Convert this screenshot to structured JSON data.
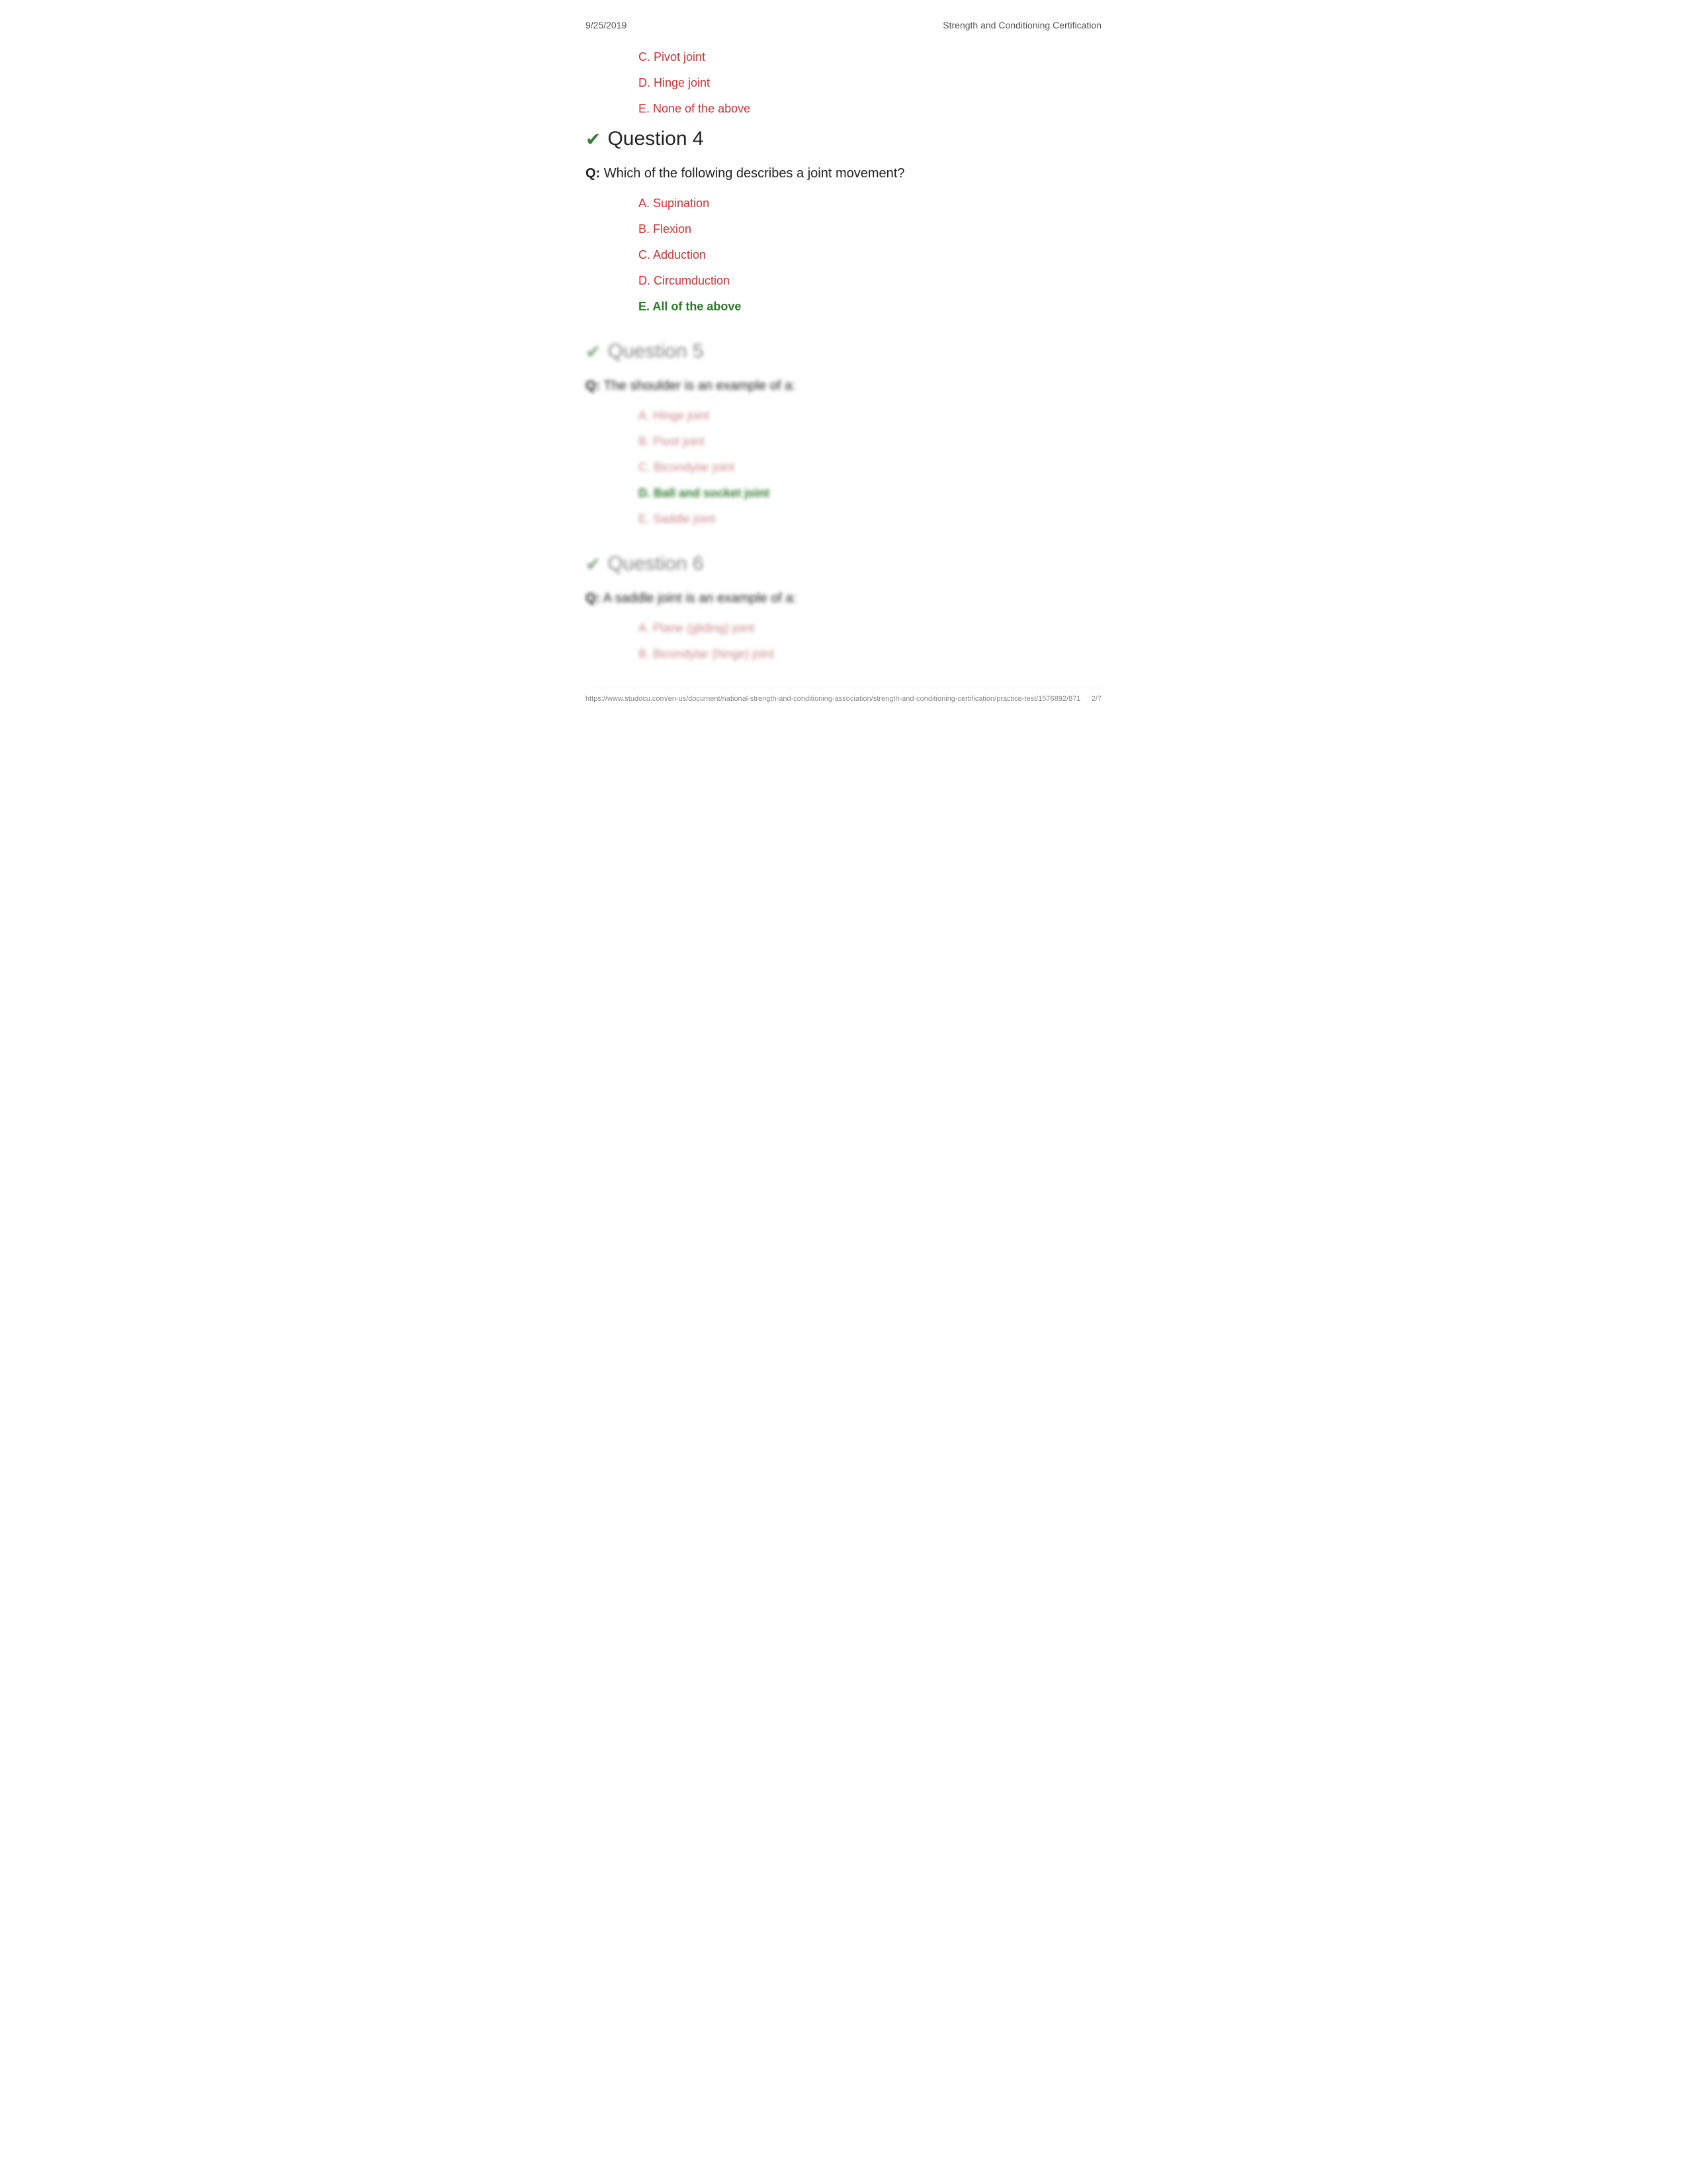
{
  "header": {
    "date": "9/25/2019",
    "title": "Strength and Conditioning Certification"
  },
  "previous_options": [
    {
      "label": "C. Pivot joint",
      "correct": false
    },
    {
      "label": "D. Hinge joint",
      "correct": false
    },
    {
      "label": "E. None of the above",
      "correct": false
    }
  ],
  "question4": {
    "number": "Question 4",
    "question_prefix": "Q:",
    "question_text": "Which of the following describes a joint movement?",
    "options": [
      {
        "label": "A. Supination",
        "correct": false
      },
      {
        "label": "B. Flexion",
        "correct": false
      },
      {
        "label": "C. Adduction",
        "correct": false
      },
      {
        "label": "D. Circumduction",
        "correct": false
      },
      {
        "label": "E. All of the above",
        "correct": true
      }
    ]
  },
  "question5": {
    "number": "Question 5",
    "question_text": "The shoulder is an example of a:",
    "options": [
      {
        "label": "A. Hinge joint",
        "correct": false
      },
      {
        "label": "B. Pivot joint",
        "correct": false
      },
      {
        "label": "C. Bicondylar joint",
        "correct": false
      },
      {
        "label": "D. Ball and socket joint",
        "correct": true
      },
      {
        "label": "E. Saddle joint",
        "correct": false
      }
    ]
  },
  "question6": {
    "number": "Question 6",
    "question_text": "A saddle joint is an example of a:",
    "options": [
      {
        "label": "A. Plane (gliding) joint",
        "correct": false
      },
      {
        "label": "B. Bicondylar (hinge) joint",
        "correct": false
      }
    ]
  },
  "footer": {
    "url": "https://www.studocu.com/en-us/document/national-strength-and-conditioning-association/strength-and-conditioning-certification/practice-test/1576892/871",
    "page": "2/7"
  }
}
